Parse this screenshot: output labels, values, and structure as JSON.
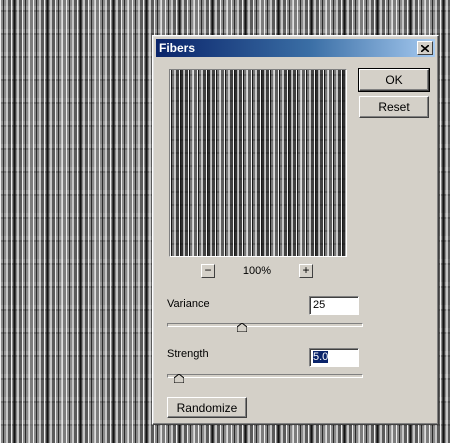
{
  "dialog": {
    "title": "Fibers",
    "ok_label": "OK",
    "reset_label": "Reset",
    "zoom_out_label": "−",
    "zoom_in_label": "+",
    "zoom_level": "100%",
    "variance": {
      "label": "Variance",
      "value": "25",
      "min": 1,
      "max": 64,
      "level": 25
    },
    "strength": {
      "label": "Strength",
      "value": "5.0",
      "min": 1,
      "max": 64,
      "level": 5
    },
    "randomize_label": "Randomize"
  },
  "colors": {
    "dialog_bg": "#d4d0c8",
    "titlebar_start": "#0a246a",
    "titlebar_end": "#a6caf0",
    "selection": "#0a246a"
  },
  "icons": {
    "close": "close-icon",
    "slider_thumb": "slider-thumb-icon"
  }
}
